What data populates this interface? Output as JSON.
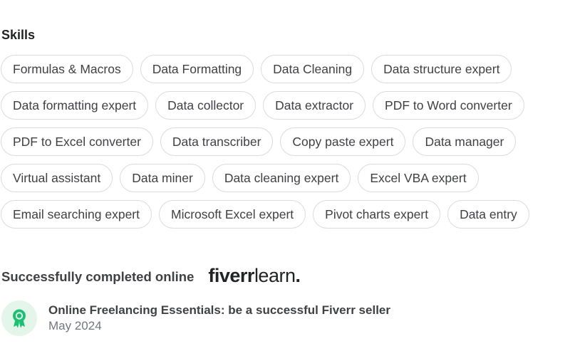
{
  "skills": {
    "heading": "Skills",
    "rows": [
      [
        "Formulas & Macros",
        "Data Formatting",
        "Data Cleaning",
        "Data structure expert"
      ],
      [
        "Data formatting expert",
        "Data collector",
        "Data extractor",
        "PDF to Word converter"
      ],
      [
        "PDF to Excel converter",
        "Data transcriber",
        "Copy paste expert",
        "Data manager"
      ],
      [
        "Virtual assistant",
        "Data miner",
        "Data cleaning expert",
        "Excel VBA expert"
      ],
      [
        "Email searching expert",
        "Microsoft Excel expert",
        "Pivot charts expert",
        "Data entry"
      ]
    ]
  },
  "learn": {
    "label": "Successfully completed online",
    "logo_part1": "fiverr",
    "logo_part2": "learn",
    "logo_dot": ".",
    "badge_icon": "award-ribbon-icon",
    "badge_color": "#1dbf73",
    "course_title": "Online Freelancing Essentials: be a successful Fiverr seller",
    "course_date": "May 2024"
  }
}
